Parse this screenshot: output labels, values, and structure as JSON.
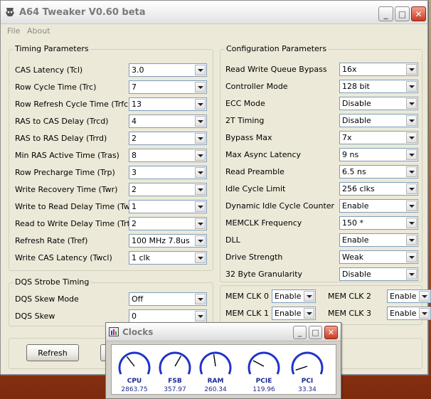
{
  "window": {
    "title": "A64 Tweaker V0.60 beta",
    "icon": "app-icon",
    "controls": {
      "minimize": "_",
      "maximize": "□",
      "close": "✕"
    }
  },
  "menu": {
    "file": "File",
    "about": "About"
  },
  "timing": {
    "title": "Timing Parameters",
    "rows": [
      {
        "label": "CAS Latency (Tcl)",
        "value": "3.0"
      },
      {
        "label": "Row Cycle Time (Trc)",
        "value": "7"
      },
      {
        "label": "Row Refresh Cycle Time (Trfc)",
        "value": "13"
      },
      {
        "label": "RAS to CAS Delay (Trcd)",
        "value": "4"
      },
      {
        "label": "RAS to RAS Delay (Trrd)",
        "value": "2"
      },
      {
        "label": "Min RAS Active Time (Tras)",
        "value": "8"
      },
      {
        "label": "Row Precharge Time (Trp)",
        "value": "3"
      },
      {
        "label": "Write Recovery Time (Twr)",
        "value": "2"
      },
      {
        "label": "Write to Read Delay Time (Twtr)",
        "value": "1"
      },
      {
        "label": "Read to Write Delay Time (Trtw)",
        "value": "2"
      },
      {
        "label": "Refresh Rate (Tref)",
        "value": "100 MHz 7.8us"
      },
      {
        "label": "Write CAS Latency (Twcl)",
        "value": "1 clk"
      }
    ]
  },
  "dqs": {
    "title": "DQS Strobe Timing",
    "rows": [
      {
        "label": "DQS Skew Mode",
        "value": "Off"
      },
      {
        "label": "DQS Skew",
        "value": "0"
      }
    ]
  },
  "config": {
    "title": "Configuration Parameters",
    "rows": [
      {
        "label": "Read Write Queue Bypass",
        "value": "16x"
      },
      {
        "label": "Controller Mode",
        "value": "128 bit"
      },
      {
        "label": "ECC Mode",
        "value": "Disable"
      },
      {
        "label": "2T Timing",
        "value": "Disable"
      },
      {
        "label": "Bypass Max",
        "value": "7x"
      },
      {
        "label": "Max Async Latency",
        "value": "9 ns"
      },
      {
        "label": "Read Preamble",
        "value": "6.5 ns"
      },
      {
        "label": "Idle Cycle Limit",
        "value": "256 clks"
      },
      {
        "label": "Dynamic Idle Cycle Counter",
        "value": "Enable"
      },
      {
        "label": "MEMCLK Frequency",
        "value": "150 *"
      },
      {
        "label": "DLL",
        "value": "Enable"
      },
      {
        "label": "Drive Strength",
        "value": "Weak"
      },
      {
        "label": "32 Byte Granularity",
        "value": "Disable"
      }
    ]
  },
  "memclk": [
    {
      "label": "MEM CLK 0",
      "value": "Enable"
    },
    {
      "label": "MEM CLK 2",
      "value": "Enable"
    },
    {
      "label": "MEM CLK 1",
      "value": "Enable"
    },
    {
      "label": "MEM CLK 3",
      "value": "Enable"
    }
  ],
  "buttons": {
    "refresh": "Refresh"
  },
  "clocks": {
    "title": "Clocks",
    "gauges": [
      {
        "name": "CPU",
        "value": "2863.75",
        "angle": -38
      },
      {
        "name": "FSB",
        "value": "357.97",
        "angle": 30
      },
      {
        "name": "RAM",
        "value": "260.34",
        "angle": -8
      },
      {
        "name": "PCIE",
        "value": "119.96",
        "angle": -62
      },
      {
        "name": "PCI",
        "value": "33.34",
        "angle": -108
      }
    ]
  },
  "colors": {
    "gauge_blue": "#1b2a8f",
    "gauge_arc": "#1f33c9"
  }
}
